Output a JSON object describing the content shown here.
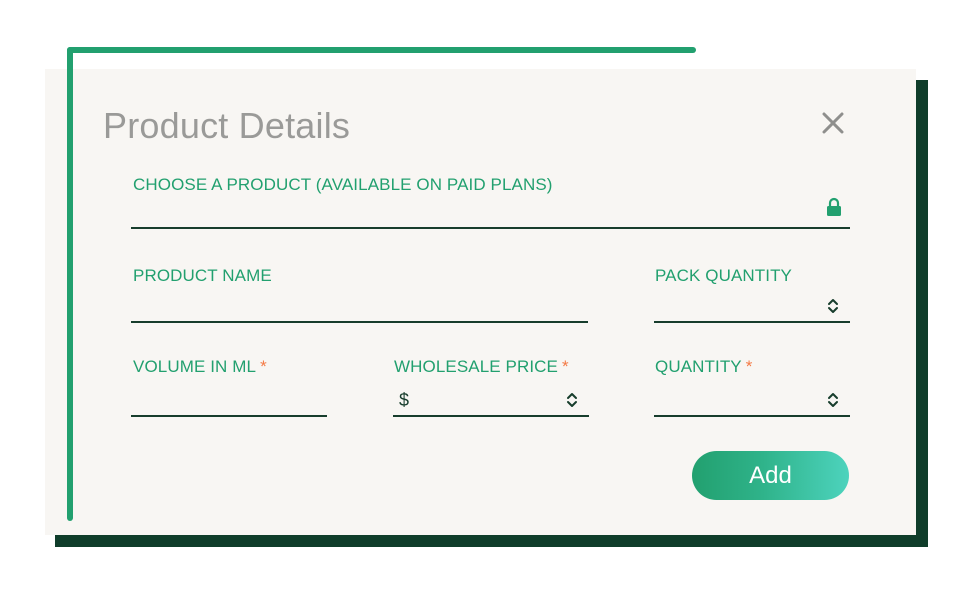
{
  "dialog": {
    "title": "Product Details",
    "close_icon": "close-icon"
  },
  "fields": {
    "choose_product": {
      "label": "CHOOSE A PRODUCT (AVAILABLE ON PAID PLANS)",
      "value": "",
      "locked": true,
      "icon": "lock-icon"
    },
    "product_name": {
      "label": "PRODUCT NAME",
      "value": ""
    },
    "pack_quantity": {
      "label": "PACK QUANTITY",
      "value": "",
      "icon": "spinner-icon"
    },
    "volume_ml": {
      "label": "VOLUME IN ML",
      "required_mark": "*",
      "value": ""
    },
    "wholesale_price": {
      "label": "WHOLESALE PRICE",
      "required_mark": "*",
      "currency": "$",
      "value": "",
      "icon": "spinner-icon"
    },
    "quantity": {
      "label": "QUANTITY",
      "required_mark": "*",
      "value": "",
      "icon": "spinner-icon"
    }
  },
  "actions": {
    "add_label": "Add"
  },
  "colors": {
    "accent_green": "#22a06f",
    "dark_green": "#0f3d2a",
    "panel_bg": "#f8f6f3",
    "required_orange": "#f47a45",
    "title_gray": "#9a9a98"
  }
}
